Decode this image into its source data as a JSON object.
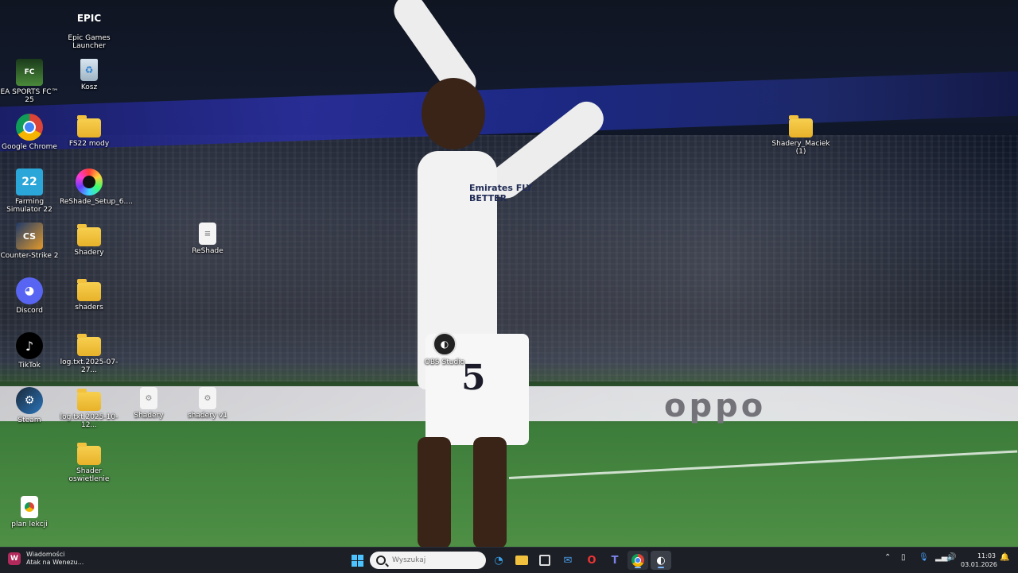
{
  "desktop_icons": [
    {
      "label": "Epic Games Launcher",
      "icon": "epic-games-icon"
    },
    {
      "label": "EA SPORTS FC™ 25",
      "icon": "ea-fc-icon"
    },
    {
      "label": "Kosz",
      "icon": "recycle-bin-icon"
    },
    {
      "label": "Google Chrome",
      "icon": "chrome-icon"
    },
    {
      "label": "FS22 mody",
      "icon": "folder-icon"
    },
    {
      "label": "Farming Simulator 22",
      "icon": "farming-simulator-icon"
    },
    {
      "label": "ReShade_Setup_6....",
      "icon": "reshade-setup-icon"
    },
    {
      "label": "Counter-Strike 2",
      "icon": "counter-strike-icon"
    },
    {
      "label": "Shadery",
      "icon": "folder-icon"
    },
    {
      "label": "ReShade",
      "icon": "text-file-icon"
    },
    {
      "label": "Discord",
      "icon": "discord-icon"
    },
    {
      "label": "shaders",
      "icon": "folder-icon"
    },
    {
      "label": "TikTok",
      "icon": "tiktok-icon"
    },
    {
      "label": "log.txt.2025-07-27...",
      "icon": "folder-icon"
    },
    {
      "label": "OBS Studio",
      "icon": "obs-icon"
    },
    {
      "label": "Steam",
      "icon": "steam-icon"
    },
    {
      "label": "log.txt.2025-10-12...",
      "icon": "folder-icon"
    },
    {
      "label": "Shadery",
      "icon": "file-icon"
    },
    {
      "label": "shadery v1",
      "icon": "file-icon"
    },
    {
      "label": "Shader oswietlenie",
      "icon": "folder-icon"
    },
    {
      "label": "plan lekcji",
      "icon": "chrome-document-icon"
    },
    {
      "label": "Shadery_Maciek (1)",
      "icon": "folder-icon"
    }
  ],
  "wallpaper": {
    "sponsor": "Emirates FLY BETTER",
    "shirt_number": "5",
    "adboard": "oppo"
  },
  "taskbar": {
    "notification": {
      "title": "Wiadomości",
      "subtitle": "Atak na Wenezu..."
    },
    "search_placeholder": "Wyszukaj",
    "pinned": [
      "start-icon",
      "edge-icon",
      "file-explorer-icon",
      "store-icon",
      "mail-icon",
      "opera-icon",
      "teams-icon",
      "chrome-icon",
      "obs-icon"
    ],
    "time": "11:03",
    "date": "03.01.2026"
  },
  "colors": {
    "taskbar_bg": "#1c2026",
    "folder": "#f2c23e",
    "accent": "#7fb8ff"
  }
}
